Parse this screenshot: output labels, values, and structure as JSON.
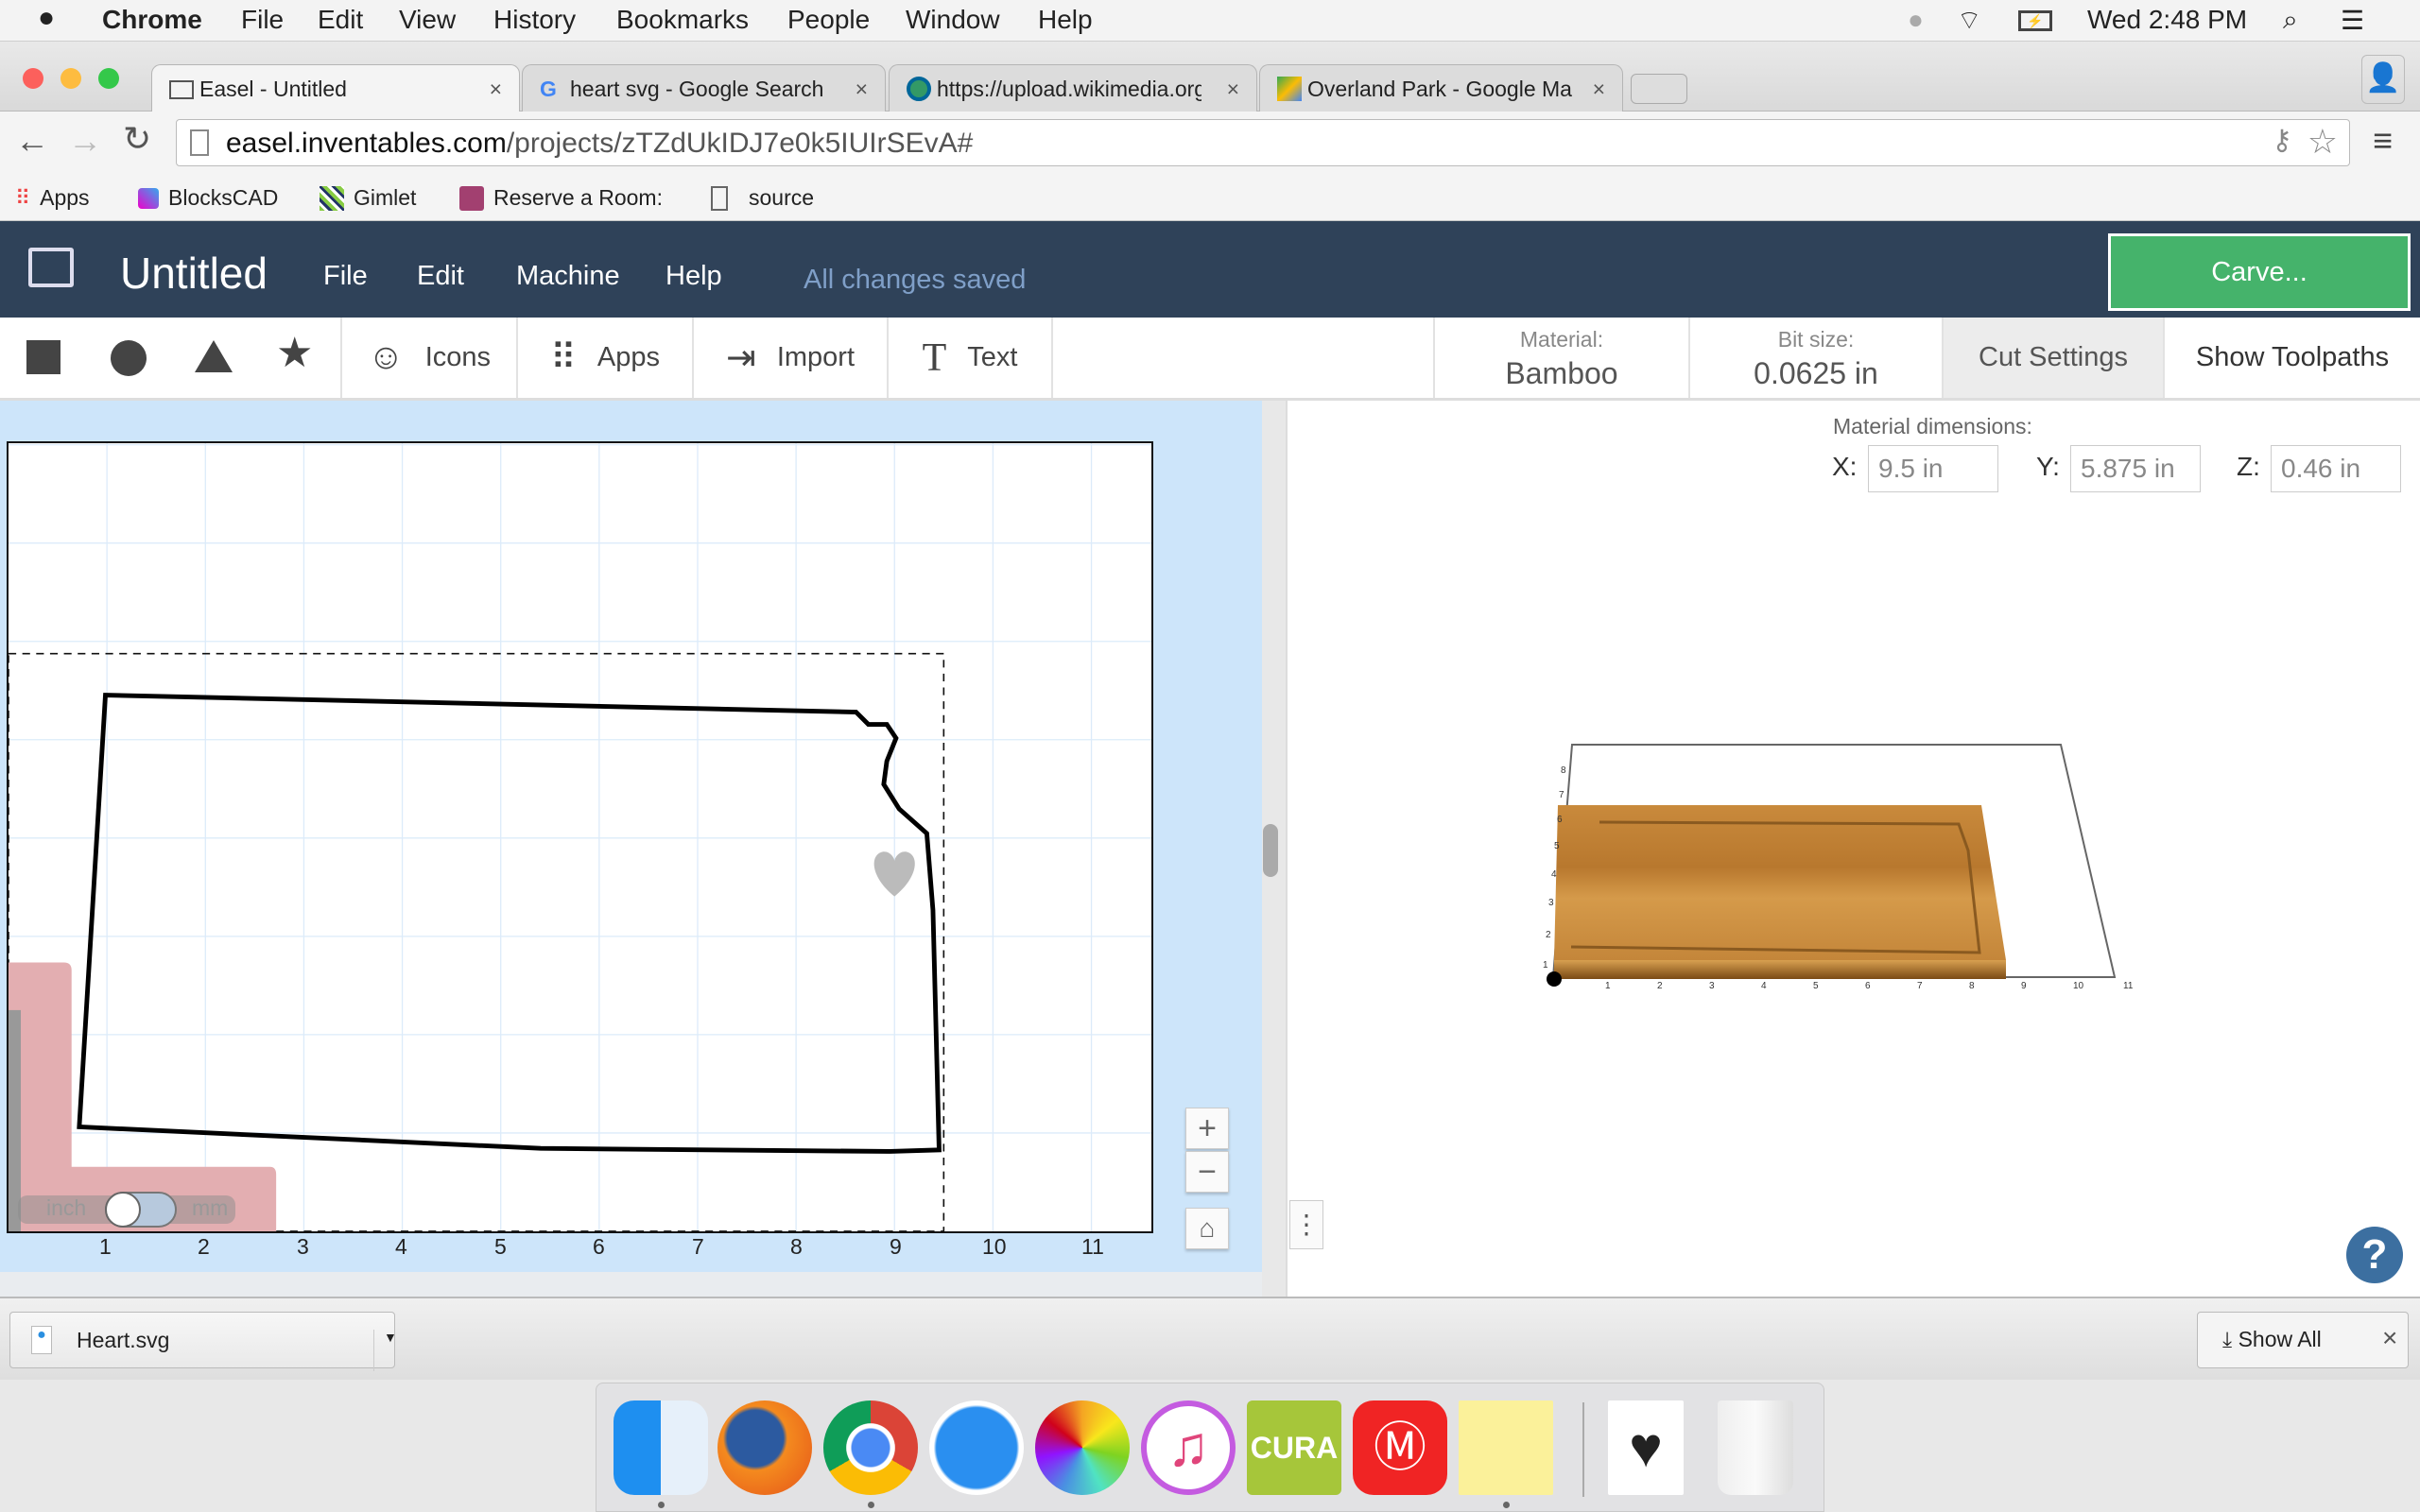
{
  "menubar": {
    "app": "Chrome",
    "items": [
      "File",
      "Edit",
      "View",
      "History",
      "Bookmarks",
      "People",
      "Window",
      "Help"
    ],
    "clock": "Wed 2:48 PM"
  },
  "tabs": [
    {
      "title": "Easel - Untitled",
      "active": true
    },
    {
      "title": "heart svg - Google Search"
    },
    {
      "title": "https://upload.wikimedia.org"
    },
    {
      "title": "Overland Park - Google Maps"
    }
  ],
  "address": {
    "host": "easel.inventables.com",
    "path": "/projects/zTZdUkIDJ7e0k5IUIrSEvA#"
  },
  "bookmarks": [
    "Apps",
    "BlocksCAD",
    "Gimlet",
    "Reserve a Room:",
    "source"
  ],
  "app": {
    "title": "Untitled",
    "menu": [
      "File",
      "Edit",
      "Machine",
      "Help"
    ],
    "status": "All changes saved",
    "carve": "Carve...",
    "colors": {
      "header": "#2f4259",
      "carve": "#45b36b",
      "help": "#3c6fa0"
    },
    "toolbar": {
      "icons": "Icons",
      "apps": "Apps",
      "import": "Import",
      "text": "Text"
    },
    "material_label": "Material:",
    "material": "Bamboo",
    "bit_label": "Bit size:",
    "bit": "0.0625 in",
    "cut_settings": "Cut Settings",
    "show_toolpaths": "Show Toolpaths",
    "dims": {
      "label": "Material dimensions:",
      "x_label": "X:",
      "x": "9.5 in",
      "y_label": "Y:",
      "y": "5.875 in",
      "z_label": "Z:",
      "z": "0.46 in"
    },
    "ruler": [
      "1",
      "2",
      "3",
      "4",
      "5",
      "6",
      "7",
      "8",
      "9",
      "10",
      "11"
    ],
    "units": {
      "inch": "inch",
      "mm": "mm"
    },
    "preview_x_ticks": [
      "1",
      "2",
      "3",
      "4",
      "5",
      "6",
      "7",
      "8",
      "9",
      "10",
      "11"
    ],
    "preview_y_ticks": [
      "1",
      "2",
      "3",
      "4",
      "5",
      "6",
      "7",
      "8"
    ]
  },
  "downloads": {
    "file": "Heart.svg",
    "show_all": "Show All"
  },
  "dock": [
    "Finder",
    "Firefox",
    "Chrome",
    "Safari",
    "Photos",
    "iTunes",
    "Cura",
    "MakerBot",
    "Stickies",
    "Heart",
    "Trash"
  ]
}
